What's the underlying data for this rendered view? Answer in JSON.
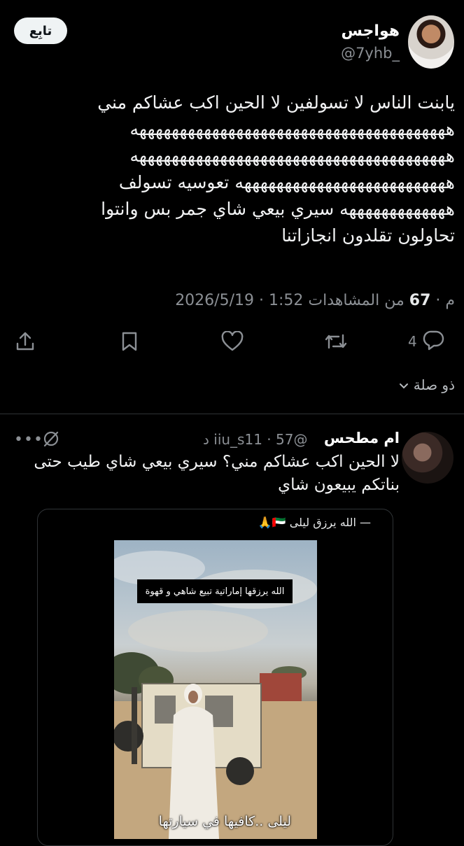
{
  "post": {
    "display_name": "هواجس",
    "handle": "@7yhb_",
    "follow_label": "تابِع",
    "lines": [
      "يابنت الناس لا تسولفين لا الحين اكب عشاكم مني",
      "هههههههههههههههههههههههههههههههههههههههه",
      "هههههههههههههههههههههههههههههههههههههههه",
      "ههههههههههههههههههههههههههه تعوسيه تسولف",
      "هههههههههههههه سيري بيعي شاي جمر بس وانتوا",
      "تحاولون تقلدون انجازاتنا"
    ],
    "date": "2026/5/19",
    "time": "1:52 م",
    "views_count": "67",
    "views_label": "من المشاهدات"
  },
  "actions": {
    "reply_count": "4"
  },
  "related_label": "ذو صلة",
  "reply": {
    "display_name": "ام مطحس",
    "handle": "@iiu_s11",
    "time": "57 د",
    "lines": [
      "لا الحين اكب عشاكم مني؟ سيري بيعي شاي طيب حتى",
      "بناتكم يبيعون شاي"
    ],
    "media": {
      "caption": "— الله يرزق ليلى 🇦🇪🙏",
      "video_top_text": "الله يرزقها إماراتية تبيع شاهي و قهوة",
      "video_bottom_text": "ليلى ..كافيها في سيارتها"
    }
  },
  "colors": {
    "background": "#000000",
    "text": "#e7e9ea",
    "muted": "#8b8f94",
    "divider": "#2f3336"
  }
}
